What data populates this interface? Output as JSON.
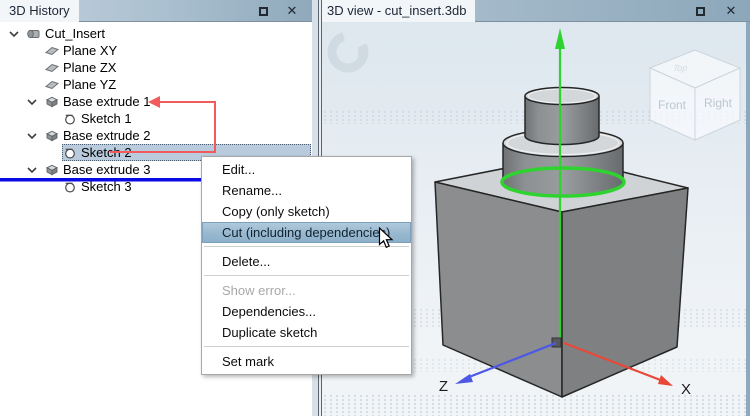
{
  "left_panel": {
    "title": "3D History",
    "window_buttons": {
      "maximize_icon": "maximize-icon",
      "close_glyph": "✕"
    },
    "tree": [
      {
        "label": "Cut_Insert",
        "level": 0,
        "icon": "part",
        "chevron": true,
        "selected": false
      },
      {
        "label": "Plane XY",
        "level": 1,
        "icon": "plane",
        "chevron": false,
        "selected": false
      },
      {
        "label": "Plane ZX",
        "level": 1,
        "icon": "plane",
        "chevron": false,
        "selected": false
      },
      {
        "label": "Plane YZ",
        "level": 1,
        "icon": "plane",
        "chevron": false,
        "selected": false
      },
      {
        "label": "Base extrude 1",
        "level": 1,
        "icon": "extrude",
        "chevron": true,
        "selected": false
      },
      {
        "label": "Sketch 1",
        "level": 2,
        "icon": "sketch",
        "chevron": false,
        "selected": false
      },
      {
        "label": "Base extrude 2",
        "level": 1,
        "icon": "extrude",
        "chevron": true,
        "selected": false
      },
      {
        "label": "Sketch 2",
        "level": 2,
        "icon": "sketch",
        "chevron": false,
        "selected": true
      },
      {
        "label": "Base extrude 3",
        "level": 1,
        "icon": "extrude",
        "chevron": true,
        "selected": false
      },
      {
        "label": "Sketch 3",
        "level": 2,
        "icon": "sketch",
        "chevron": false,
        "selected": false
      }
    ]
  },
  "right_panel": {
    "title": "3D view - cut_insert.3db",
    "window_buttons": {
      "maximize_icon": "maximize-icon",
      "close_glyph": "✕"
    },
    "viewport": {
      "axis_labels": {
        "x": "X",
        "z": "Z"
      },
      "nav_cube": {
        "top": "Top",
        "front": "Front",
        "right": "Right"
      }
    }
  },
  "context_menu": {
    "items": [
      {
        "label": "Edit..."
      },
      {
        "label": "Rename..."
      },
      {
        "label": "Copy (only sketch)"
      },
      {
        "label": "Cut (including dependencies)",
        "highlighted": true
      },
      {
        "separator": true
      },
      {
        "label": "Delete..."
      },
      {
        "separator": true
      },
      {
        "label": "Show error...",
        "disabled": true
      },
      {
        "label": "Dependencies..."
      },
      {
        "label": "Duplicate sketch"
      },
      {
        "separator": true
      },
      {
        "label": "Set mark"
      }
    ]
  },
  "colors": {
    "accent_green": "#2fd32f",
    "axis_x_red": "#e84838",
    "axis_z_blue": "#4d58e6",
    "annotation_red": "#f15b5b",
    "drop_indicator_blue": "#0a0ae6",
    "selection_bg": "#b9cbdc",
    "menu_highlight": "#98b8cf",
    "titlebar_bg": "#a9bfcf",
    "tab_bg": "#f3f6f9"
  }
}
